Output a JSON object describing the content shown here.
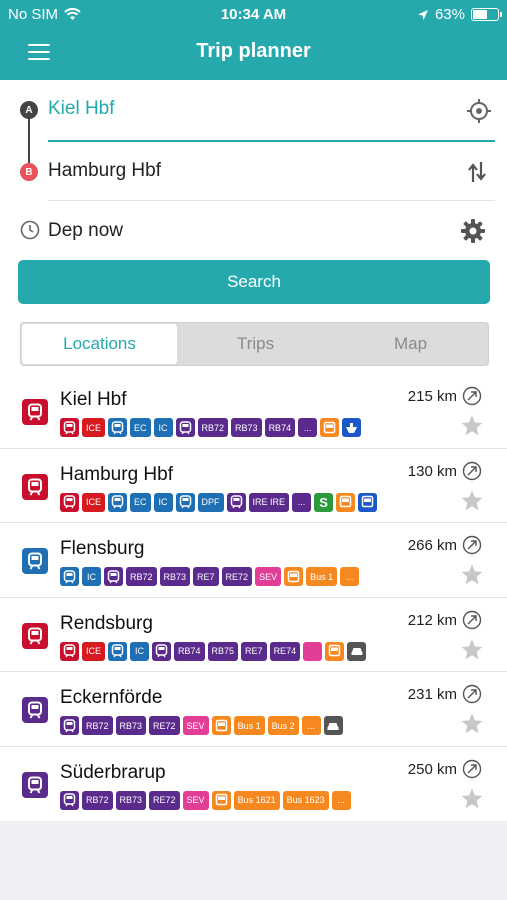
{
  "status_bar": {
    "carrier": "No SIM",
    "time": "10:34 AM",
    "battery_text": "63%",
    "battery_level": 0.63
  },
  "header": {
    "title": "Trip planner"
  },
  "form": {
    "from_label": "A",
    "to_label": "B",
    "from_value": "Kiel Hbf",
    "to_value": "Hamburg Hbf",
    "departure": "Dep now",
    "search_label": "Search"
  },
  "tabs": [
    {
      "label": "Locations",
      "active": true
    },
    {
      "label": "Trips",
      "active": false
    },
    {
      "label": "Map",
      "active": false
    }
  ],
  "colors": {
    "accent": "#26a9ad",
    "rail_red": "#c8102e",
    "ice": "#d71920",
    "ic_blue": "#1f6fb4",
    "regional_purple": "#5a2a8c",
    "sev_pink": "#e23d97",
    "bus_orange": "#f5891f",
    "sbahn_green": "#2a9a3a",
    "ferry_blue": "#1c58c7",
    "taxi_grey": "#555555"
  },
  "locations": [
    {
      "name": "Kiel Hbf",
      "distance": "215 km",
      "type_icon": "train-red",
      "badges": [
        {
          "t": "",
          "c": "rail_red",
          "icon": "train"
        },
        {
          "t": "ICE",
          "c": "ice"
        },
        {
          "t": "",
          "c": "ic_blue",
          "icon": "train"
        },
        {
          "t": "EC",
          "c": "ic_blue"
        },
        {
          "t": "IC",
          "c": "ic_blue"
        },
        {
          "t": "",
          "c": "regional_purple",
          "icon": "train"
        },
        {
          "t": "RB72",
          "c": "regional_purple"
        },
        {
          "t": "RB73",
          "c": "regional_purple"
        },
        {
          "t": "RB74",
          "c": "regional_purple"
        },
        {
          "t": "...",
          "c": "regional_purple"
        },
        {
          "t": "",
          "c": "bus_orange",
          "icon": "bus"
        },
        {
          "t": "",
          "c": "ferry_blue",
          "icon": "ferry"
        }
      ]
    },
    {
      "name": "Hamburg Hbf",
      "distance": "130 km",
      "type_icon": "train-red",
      "badges": [
        {
          "t": "",
          "c": "rail_red",
          "icon": "train"
        },
        {
          "t": "ICE",
          "c": "ice"
        },
        {
          "t": "",
          "c": "ic_blue",
          "icon": "train"
        },
        {
          "t": "EC",
          "c": "ic_blue"
        },
        {
          "t": "IC",
          "c": "ic_blue"
        },
        {
          "t": "",
          "c": "ic_blue",
          "icon": "train"
        },
        {
          "t": "DPF",
          "c": "ic_blue"
        },
        {
          "t": "",
          "c": "regional_purple",
          "icon": "train"
        },
        {
          "t": "IRE IRE",
          "c": "regional_purple"
        },
        {
          "t": "...",
          "c": "regional_purple"
        },
        {
          "t": "S",
          "c": "sbahn_green"
        },
        {
          "t": "",
          "c": "bus_orange",
          "icon": "bus"
        },
        {
          "t": "",
          "c": "ferry_blue",
          "icon": "bus"
        }
      ]
    },
    {
      "name": "Flensburg",
      "distance": "266 km",
      "type_icon": "train-blue",
      "badges": [
        {
          "t": "",
          "c": "ic_blue",
          "icon": "train"
        },
        {
          "t": "IC",
          "c": "ic_blue"
        },
        {
          "t": "",
          "c": "regional_purple",
          "icon": "train"
        },
        {
          "t": "RB72",
          "c": "regional_purple"
        },
        {
          "t": "RB73",
          "c": "regional_purple"
        },
        {
          "t": "RE7",
          "c": "regional_purple"
        },
        {
          "t": "RE72",
          "c": "regional_purple"
        },
        {
          "t": "SEV",
          "c": "sev_pink"
        },
        {
          "t": "",
          "c": "bus_orange",
          "icon": "bus"
        },
        {
          "t": "Bus 1",
          "c": "bus_orange"
        },
        {
          "t": "...",
          "c": "bus_orange"
        }
      ]
    },
    {
      "name": "Rendsburg",
      "distance": "212 km",
      "type_icon": "train-red",
      "badges": [
        {
          "t": "",
          "c": "rail_red",
          "icon": "train"
        },
        {
          "t": "ICE",
          "c": "ice"
        },
        {
          "t": "",
          "c": "ic_blue",
          "icon": "train"
        },
        {
          "t": "IC",
          "c": "ic_blue"
        },
        {
          "t": "",
          "c": "regional_purple",
          "icon": "train"
        },
        {
          "t": "RB74",
          "c": "regional_purple"
        },
        {
          "t": "RB75",
          "c": "regional_purple"
        },
        {
          "t": "RE7",
          "c": "regional_purple"
        },
        {
          "t": "RE74",
          "c": "regional_purple"
        },
        {
          "t": "",
          "c": "sev_pink",
          "icon": "none"
        },
        {
          "t": "",
          "c": "bus_orange",
          "icon": "bus"
        },
        {
          "t": "",
          "c": "taxi_grey",
          "icon": "taxi"
        }
      ]
    },
    {
      "name": "Eckernförde",
      "distance": "231 km",
      "type_icon": "train-purple",
      "badges": [
        {
          "t": "",
          "c": "regional_purple",
          "icon": "train"
        },
        {
          "t": "RB72",
          "c": "regional_purple"
        },
        {
          "t": "RB73",
          "c": "regional_purple"
        },
        {
          "t": "RE72",
          "c": "regional_purple"
        },
        {
          "t": "SEV",
          "c": "sev_pink"
        },
        {
          "t": "",
          "c": "bus_orange",
          "icon": "bus"
        },
        {
          "t": "Bus 1",
          "c": "bus_orange"
        },
        {
          "t": "Bus 2",
          "c": "bus_orange"
        },
        {
          "t": "...",
          "c": "bus_orange"
        },
        {
          "t": "",
          "c": "taxi_grey",
          "icon": "taxi"
        }
      ]
    },
    {
      "name": "Süderbrarup",
      "distance": "250 km",
      "type_icon": "train-purple",
      "badges": [
        {
          "t": "",
          "c": "regional_purple",
          "icon": "train"
        },
        {
          "t": "RB72",
          "c": "regional_purple"
        },
        {
          "t": "RB73",
          "c": "regional_purple"
        },
        {
          "t": "RE72",
          "c": "regional_purple"
        },
        {
          "t": "SEV",
          "c": "sev_pink"
        },
        {
          "t": "",
          "c": "bus_orange",
          "icon": "bus"
        },
        {
          "t": "Bus 1621",
          "c": "bus_orange"
        },
        {
          "t": "Bus 1623",
          "c": "bus_orange"
        },
        {
          "t": "...",
          "c": "bus_orange"
        }
      ]
    }
  ]
}
